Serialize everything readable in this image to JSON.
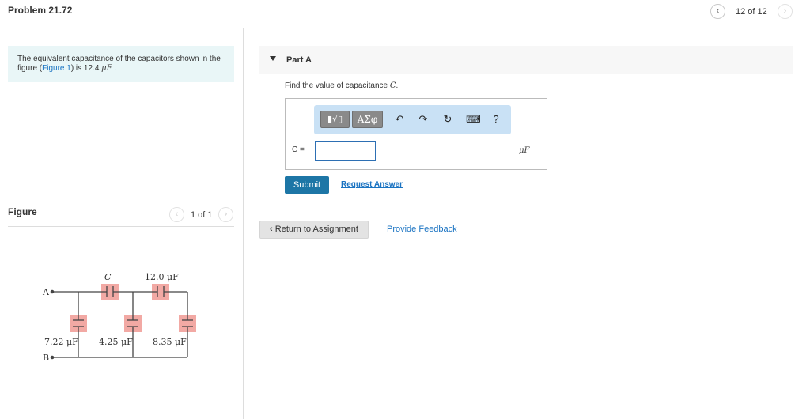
{
  "header": {
    "title": "Problem 21.72",
    "prev_icon": "‹",
    "next_icon": "›",
    "page_counter": "12 of 12"
  },
  "intro": {
    "text_before": "The equivalent capacitance of the capacitors shown in the figure (",
    "figure_link": "Figure 1",
    "text_after": ") is 12.4 ",
    "value_unit": "μF",
    "text_end": " ."
  },
  "figure": {
    "label": "Figure",
    "prev_icon": "‹",
    "next_icon": "›",
    "counter": "1 of 1",
    "terminal_a": "A",
    "terminal_b": "B",
    "cap_c_label": "C",
    "cap_top_right_label": "12.0 μF",
    "cap_1_label": "7.22 μF",
    "cap_2_label": "4.25 μF",
    "cap_3_label": "8.35 μF",
    "highlight_color": "#f2a9a4",
    "wire_color": "#444444"
  },
  "part_a": {
    "label": "Part A",
    "prompt_before": "Find the value of capacitance ",
    "prompt_var": "C",
    "prompt_after": ".",
    "toolbar": {
      "template_button": "▮√▯",
      "symbols_button": "ΑΣφ",
      "undo_icon": "↶",
      "redo_icon": "↷",
      "reset_icon": "↻",
      "keyboard_icon": "⌨",
      "help_icon": "?"
    },
    "variable_label": "C =",
    "input_value": "",
    "unit": "μF",
    "submit_label": "Submit",
    "request_answer_label": "Request Answer"
  },
  "footer": {
    "return_label": "Return to Assignment",
    "return_icon": "‹",
    "feedback_label": "Provide Feedback"
  },
  "colors": {
    "link": "#1a73c2",
    "submit_bg": "#1d76a6",
    "intro_bg": "#e9f6f7",
    "toolbar_bg": "#c9e1f5"
  }
}
